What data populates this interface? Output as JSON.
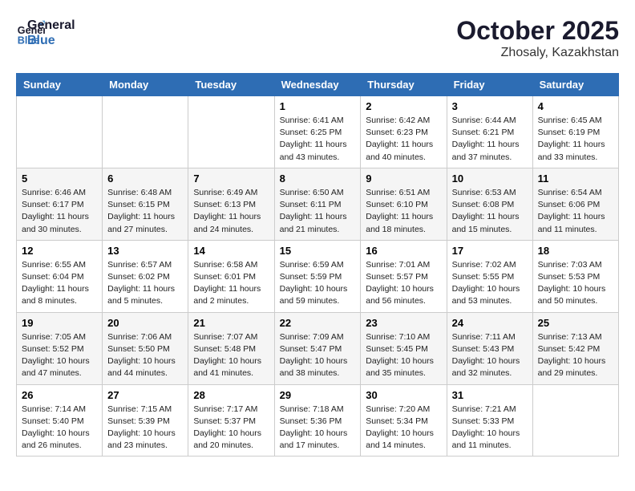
{
  "header": {
    "logo_line1": "General",
    "logo_line2": "Blue",
    "month": "October 2025",
    "location": "Zhosaly, Kazakhstan"
  },
  "weekdays": [
    "Sunday",
    "Monday",
    "Tuesday",
    "Wednesday",
    "Thursday",
    "Friday",
    "Saturday"
  ],
  "weeks": [
    [
      {
        "day": "",
        "sunrise": "",
        "sunset": "",
        "daylight": ""
      },
      {
        "day": "",
        "sunrise": "",
        "sunset": "",
        "daylight": ""
      },
      {
        "day": "",
        "sunrise": "",
        "sunset": "",
        "daylight": ""
      },
      {
        "day": "1",
        "sunrise": "Sunrise: 6:41 AM",
        "sunset": "Sunset: 6:25 PM",
        "daylight": "Daylight: 11 hours and 43 minutes."
      },
      {
        "day": "2",
        "sunrise": "Sunrise: 6:42 AM",
        "sunset": "Sunset: 6:23 PM",
        "daylight": "Daylight: 11 hours and 40 minutes."
      },
      {
        "day": "3",
        "sunrise": "Sunrise: 6:44 AM",
        "sunset": "Sunset: 6:21 PM",
        "daylight": "Daylight: 11 hours and 37 minutes."
      },
      {
        "day": "4",
        "sunrise": "Sunrise: 6:45 AM",
        "sunset": "Sunset: 6:19 PM",
        "daylight": "Daylight: 11 hours and 33 minutes."
      }
    ],
    [
      {
        "day": "5",
        "sunrise": "Sunrise: 6:46 AM",
        "sunset": "Sunset: 6:17 PM",
        "daylight": "Daylight: 11 hours and 30 minutes."
      },
      {
        "day": "6",
        "sunrise": "Sunrise: 6:48 AM",
        "sunset": "Sunset: 6:15 PM",
        "daylight": "Daylight: 11 hours and 27 minutes."
      },
      {
        "day": "7",
        "sunrise": "Sunrise: 6:49 AM",
        "sunset": "Sunset: 6:13 PM",
        "daylight": "Daylight: 11 hours and 24 minutes."
      },
      {
        "day": "8",
        "sunrise": "Sunrise: 6:50 AM",
        "sunset": "Sunset: 6:11 PM",
        "daylight": "Daylight: 11 hours and 21 minutes."
      },
      {
        "day": "9",
        "sunrise": "Sunrise: 6:51 AM",
        "sunset": "Sunset: 6:10 PM",
        "daylight": "Daylight: 11 hours and 18 minutes."
      },
      {
        "day": "10",
        "sunrise": "Sunrise: 6:53 AM",
        "sunset": "Sunset: 6:08 PM",
        "daylight": "Daylight: 11 hours and 15 minutes."
      },
      {
        "day": "11",
        "sunrise": "Sunrise: 6:54 AM",
        "sunset": "Sunset: 6:06 PM",
        "daylight": "Daylight: 11 hours and 11 minutes."
      }
    ],
    [
      {
        "day": "12",
        "sunrise": "Sunrise: 6:55 AM",
        "sunset": "Sunset: 6:04 PM",
        "daylight": "Daylight: 11 hours and 8 minutes."
      },
      {
        "day": "13",
        "sunrise": "Sunrise: 6:57 AM",
        "sunset": "Sunset: 6:02 PM",
        "daylight": "Daylight: 11 hours and 5 minutes."
      },
      {
        "day": "14",
        "sunrise": "Sunrise: 6:58 AM",
        "sunset": "Sunset: 6:01 PM",
        "daylight": "Daylight: 11 hours and 2 minutes."
      },
      {
        "day": "15",
        "sunrise": "Sunrise: 6:59 AM",
        "sunset": "Sunset: 5:59 PM",
        "daylight": "Daylight: 10 hours and 59 minutes."
      },
      {
        "day": "16",
        "sunrise": "Sunrise: 7:01 AM",
        "sunset": "Sunset: 5:57 PM",
        "daylight": "Daylight: 10 hours and 56 minutes."
      },
      {
        "day": "17",
        "sunrise": "Sunrise: 7:02 AM",
        "sunset": "Sunset: 5:55 PM",
        "daylight": "Daylight: 10 hours and 53 minutes."
      },
      {
        "day": "18",
        "sunrise": "Sunrise: 7:03 AM",
        "sunset": "Sunset: 5:53 PM",
        "daylight": "Daylight: 10 hours and 50 minutes."
      }
    ],
    [
      {
        "day": "19",
        "sunrise": "Sunrise: 7:05 AM",
        "sunset": "Sunset: 5:52 PM",
        "daylight": "Daylight: 10 hours and 47 minutes."
      },
      {
        "day": "20",
        "sunrise": "Sunrise: 7:06 AM",
        "sunset": "Sunset: 5:50 PM",
        "daylight": "Daylight: 10 hours and 44 minutes."
      },
      {
        "day": "21",
        "sunrise": "Sunrise: 7:07 AM",
        "sunset": "Sunset: 5:48 PM",
        "daylight": "Daylight: 10 hours and 41 minutes."
      },
      {
        "day": "22",
        "sunrise": "Sunrise: 7:09 AM",
        "sunset": "Sunset: 5:47 PM",
        "daylight": "Daylight: 10 hours and 38 minutes."
      },
      {
        "day": "23",
        "sunrise": "Sunrise: 7:10 AM",
        "sunset": "Sunset: 5:45 PM",
        "daylight": "Daylight: 10 hours and 35 minutes."
      },
      {
        "day": "24",
        "sunrise": "Sunrise: 7:11 AM",
        "sunset": "Sunset: 5:43 PM",
        "daylight": "Daylight: 10 hours and 32 minutes."
      },
      {
        "day": "25",
        "sunrise": "Sunrise: 7:13 AM",
        "sunset": "Sunset: 5:42 PM",
        "daylight": "Daylight: 10 hours and 29 minutes."
      }
    ],
    [
      {
        "day": "26",
        "sunrise": "Sunrise: 7:14 AM",
        "sunset": "Sunset: 5:40 PM",
        "daylight": "Daylight: 10 hours and 26 minutes."
      },
      {
        "day": "27",
        "sunrise": "Sunrise: 7:15 AM",
        "sunset": "Sunset: 5:39 PM",
        "daylight": "Daylight: 10 hours and 23 minutes."
      },
      {
        "day": "28",
        "sunrise": "Sunrise: 7:17 AM",
        "sunset": "Sunset: 5:37 PM",
        "daylight": "Daylight: 10 hours and 20 minutes."
      },
      {
        "day": "29",
        "sunrise": "Sunrise: 7:18 AM",
        "sunset": "Sunset: 5:36 PM",
        "daylight": "Daylight: 10 hours and 17 minutes."
      },
      {
        "day": "30",
        "sunrise": "Sunrise: 7:20 AM",
        "sunset": "Sunset: 5:34 PM",
        "daylight": "Daylight: 10 hours and 14 minutes."
      },
      {
        "day": "31",
        "sunrise": "Sunrise: 7:21 AM",
        "sunset": "Sunset: 5:33 PM",
        "daylight": "Daylight: 10 hours and 11 minutes."
      },
      {
        "day": "",
        "sunrise": "",
        "sunset": "",
        "daylight": ""
      }
    ]
  ]
}
